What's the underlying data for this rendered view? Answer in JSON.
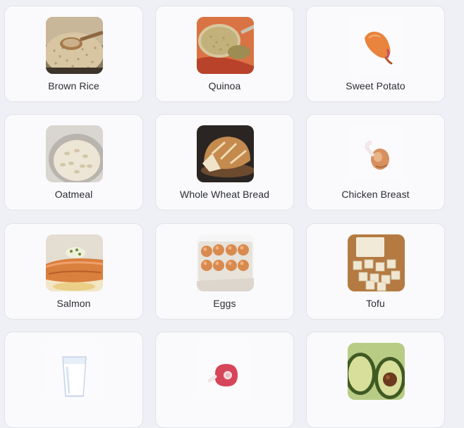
{
  "foods": [
    {
      "label": "Brown Rice",
      "icon": "brown-rice-photo"
    },
    {
      "label": "Quinoa",
      "icon": "quinoa-photo"
    },
    {
      "label": "Sweet Potato",
      "icon": "sweet-potato-icon"
    },
    {
      "label": "Oatmeal",
      "icon": "oatmeal-photo"
    },
    {
      "label": "Whole Wheat Bread",
      "icon": "bread-photo"
    },
    {
      "label": "Chicken Breast",
      "icon": "chicken-leg-icon"
    },
    {
      "label": "Salmon",
      "icon": "salmon-photo"
    },
    {
      "label": "Eggs",
      "icon": "eggs-photo"
    },
    {
      "label": "Tofu",
      "icon": "tofu-photo"
    },
    {
      "label": "",
      "icon": "milk-glass-icon"
    },
    {
      "label": "",
      "icon": "meat-steak-icon"
    },
    {
      "label": "",
      "icon": "avocado-photo"
    }
  ]
}
